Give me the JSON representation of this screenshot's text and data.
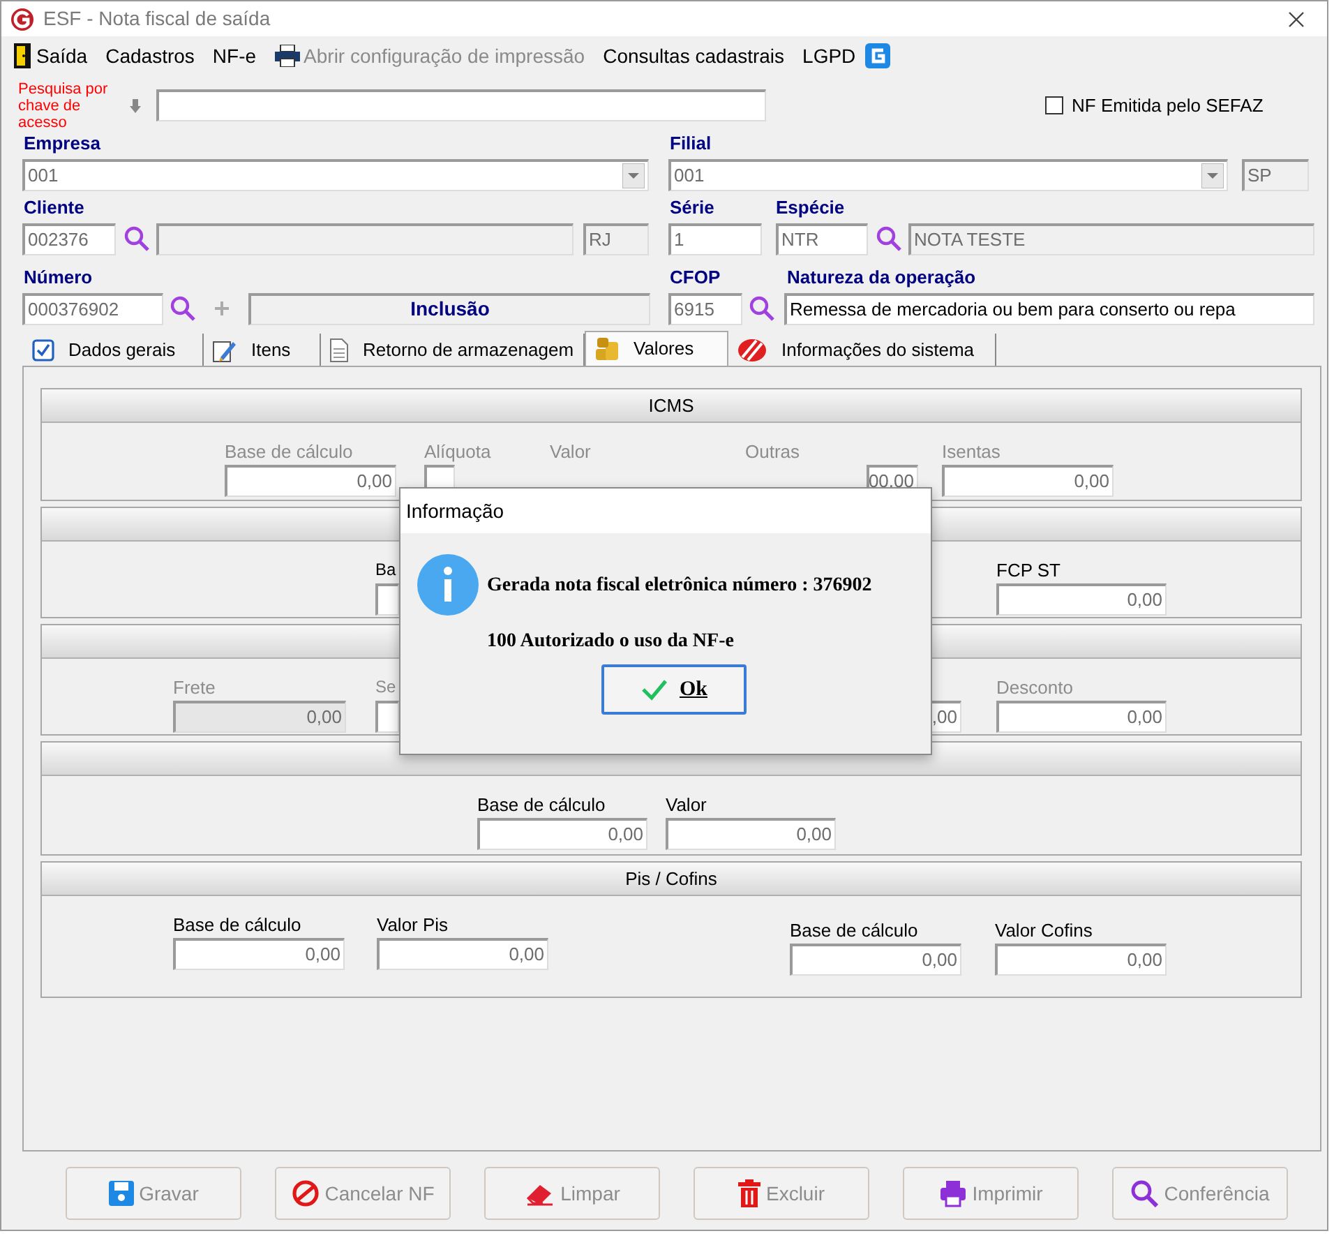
{
  "window": {
    "title": "ESF - Nota fiscal de saída"
  },
  "menu": [
    {
      "label": "Saída",
      "disabled": false
    },
    {
      "label": "Cadastros",
      "disabled": false
    },
    {
      "label": "NF-e",
      "disabled": false
    },
    {
      "label": "Abrir configuração de impressão",
      "disabled": true
    },
    {
      "label": "Consultas cadastrais",
      "disabled": false
    },
    {
      "label": "LGPD",
      "disabled": false
    }
  ],
  "search_key": {
    "label": "Pesquisa por chave de acesso"
  },
  "sefaz_checkbox": {
    "label": "NF Emitida pelo SEFAZ",
    "checked": false
  },
  "empresa": {
    "label": "Empresa",
    "value": "001"
  },
  "filial": {
    "label": "Filial",
    "value": "001",
    "uf": "SP"
  },
  "cliente": {
    "label": "Cliente",
    "code": "002376",
    "uf": "RJ"
  },
  "serie": {
    "label": "Série",
    "value": "1"
  },
  "especie": {
    "label": "Espécie",
    "code": "NTR",
    "description": "NOTA TESTE"
  },
  "numero": {
    "label": "Número",
    "value": "000376902",
    "status": "Inclusão"
  },
  "cfop": {
    "label": "CFOP",
    "value": "6915"
  },
  "natureza": {
    "label": "Natureza da operação",
    "value": "Remessa de mercadoria ou bem para conserto ou repa"
  },
  "tabs": [
    {
      "label": "Dados gerais",
      "selected": false
    },
    {
      "label": "Itens",
      "selected": false
    },
    {
      "label": "Retorno de armazenagem",
      "selected": false
    },
    {
      "label": "Valores",
      "selected": true
    },
    {
      "label": "Informações do sistema",
      "selected": false
    }
  ],
  "sections": [
    {
      "title": "ICMS",
      "fields": [
        {
          "label": "Base de cálculo",
          "value": "0,00",
          "disabled": true
        },
        {
          "label": "Alíquota",
          "disabled": true
        },
        {
          "label": "Valor",
          "disabled": true
        },
        {
          "label": "Outras",
          "disabled": true
        },
        {
          "value": "00,00"
        },
        {
          "label": "Isentas",
          "value": "0,00",
          "disabled": true
        }
      ]
    },
    {
      "fields": [
        {
          "label": "Ba",
          "disabled": false
        },
        {
          "label": "FCP ST",
          "value": "0,00",
          "disabled": false
        }
      ]
    },
    {
      "fields": [
        {
          "label": "Frete",
          "value": "0,00",
          "disabled": true,
          "locked": true
        },
        {
          "label": "Se",
          "disabled": true
        },
        {
          "value": ",00"
        },
        {
          "label": "Desconto",
          "value": "0,00",
          "disabled": true
        }
      ]
    },
    {
      "fields": [
        {
          "label": "Base de cálculo",
          "value": "0,00",
          "disabled": false
        },
        {
          "label": "Valor",
          "value": "0,00",
          "disabled": false
        }
      ]
    },
    {
      "title": "Pis / Cofins",
      "fields": [
        {
          "label": "Base de cálculo",
          "value": "0,00",
          "disabled": false
        },
        {
          "label": "Valor Pis",
          "value": "0,00",
          "disabled": false
        },
        {
          "label": "Base de cálculo",
          "value": "0,00",
          "disabled": false
        },
        {
          "label": "Valor Cofins",
          "value": "0,00",
          "disabled": false
        }
      ]
    }
  ],
  "buttons": [
    {
      "label": "Gravar",
      "disabled": true
    },
    {
      "label": "Cancelar NF",
      "disabled": true
    },
    {
      "label": "Limpar",
      "disabled": true
    },
    {
      "label": "Excluir",
      "disabled": true
    },
    {
      "label": "Imprimir",
      "disabled": true
    },
    {
      "label": "Conferência",
      "disabled": true
    }
  ],
  "dialog": {
    "title": "Informação",
    "message": "Gerada nota fiscal eletrônica número : 376902",
    "detail": "100 Autorizado o uso da NF-e",
    "button": "Ok"
  }
}
